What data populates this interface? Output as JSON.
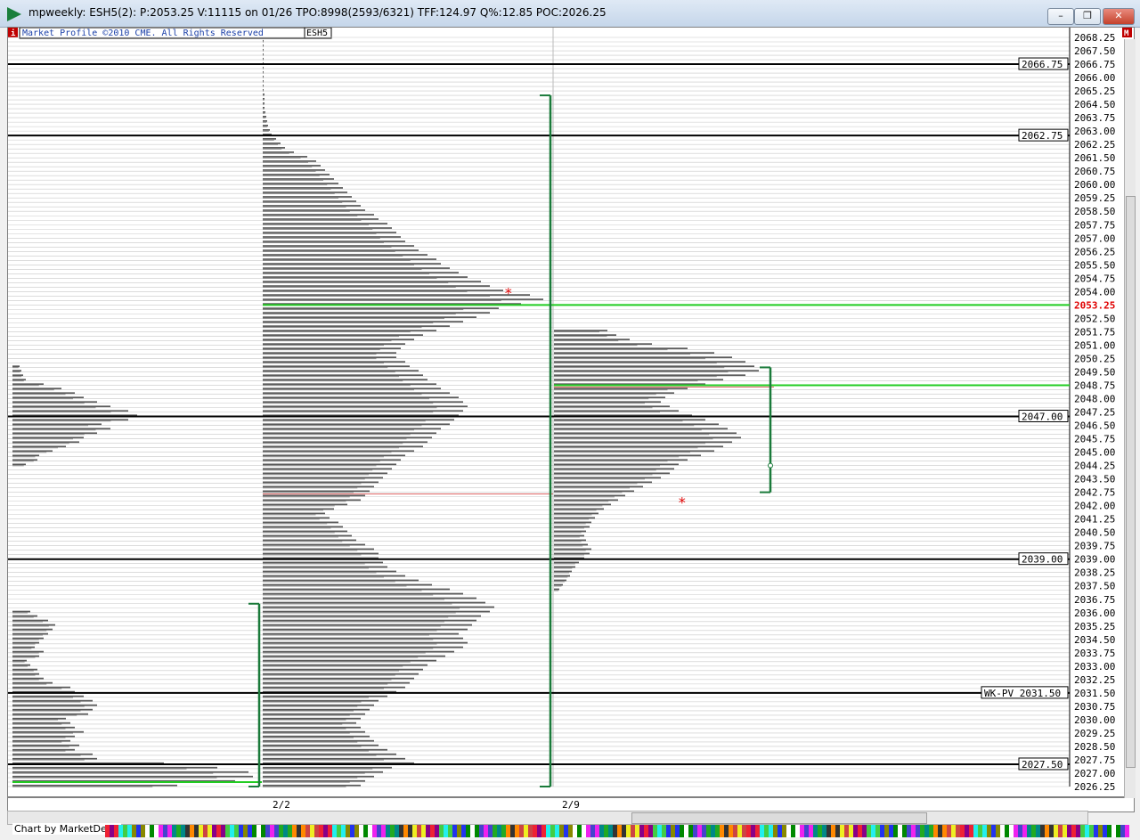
{
  "window": {
    "title": "mpweekly: ESH5(2): P:2053.25 V:11115 on 01/26 TPO:8998(2593/6321) TFF:124.97 Q%:12.85 POC:2026.25",
    "min_label": "–",
    "restore_label": "❒",
    "close_label": "✕"
  },
  "header": {
    "copyright": "Market Profile ©2010 CME. All Rights Reserved",
    "symbol": "ESH5",
    "left_corner": "i",
    "right_corner": "M"
  },
  "footer": {
    "credit": "Chart by MarketDelta"
  },
  "colors": {
    "accent_green": "#1a7f3c",
    "poc_green": "#22cc22",
    "value_area_green": "#1a7a3a",
    "current_price_red": "#e00000",
    "grid": "#c8c8c8",
    "level_line": "#000000"
  },
  "chart_data": {
    "type": "market-profile",
    "y_axis": {
      "min": 2026.25,
      "max": 2068.25,
      "tick_step": 0.25,
      "label_every": 1.25,
      "current_price": 2053.25,
      "labels": [
        "2068.25",
        "2067.50",
        "2066.75",
        "2066.00",
        "2065.25",
        "2064.50",
        "2063.75",
        "2063.00",
        "2062.25",
        "2061.50",
        "2060.75",
        "2060.00",
        "2059.25",
        "2058.50",
        "2057.75",
        "2057.00",
        "2056.25",
        "2055.50",
        "2054.75",
        "2054.00",
        "2053.25",
        "2052.50",
        "2051.75",
        "2051.00",
        "2050.25",
        "2049.50",
        "2048.75",
        "2048.00",
        "2047.25",
        "2046.50",
        "2045.75",
        "2045.00",
        "2044.25",
        "2043.50",
        "2042.75",
        "2042.00",
        "2041.25",
        "2040.50",
        "2039.75",
        "2039.00",
        "2038.25",
        "2037.50",
        "2036.75",
        "2036.00",
        "2035.25",
        "2034.50",
        "2033.75",
        "2033.00",
        "2032.25",
        "2031.50",
        "2030.75",
        "2030.00",
        "2029.25",
        "2028.50",
        "2027.75",
        "2027.00",
        "2026.25"
      ]
    },
    "x_axis": {
      "dates": [
        "2/2",
        "2/9"
      ]
    },
    "levels": [
      {
        "label": "2066.75",
        "price": 2066.75
      },
      {
        "label": "2062.75",
        "price": 2062.75
      },
      {
        "label": "2047.00",
        "price": 2047.0
      },
      {
        "label": "2039.00",
        "price": 2039.0
      },
      {
        "label": "WK-PV 2031.50",
        "price": 2031.5
      },
      {
        "label": "2027.50",
        "price": 2027.5
      }
    ],
    "profiles": [
      {
        "id": "prior-week",
        "low": 2026.25,
        "high": 2049.75,
        "poc": 2026.5,
        "value_area": [
          2026.25,
          2036.5
        ],
        "segments": [
          {
            "from": 2026.25,
            "to": 2029.25,
            "widths": [
              185,
              250,
              270,
              265,
              230,
              170,
              95,
              90,
              70,
              75,
              65,
              70,
              80
            ]
          },
          {
            "from": 2029.5,
            "to": 2036.0,
            "widths": [
              70,
              65,
              60,
              85,
              90,
              95,
              90,
              80,
              70,
              65,
              45,
              35,
              30,
              28,
              20,
              16,
              30,
              35,
              25,
              30,
              35,
              40,
              45,
              48,
              40,
              28,
              20
            ]
          },
          {
            "from": 2044.25,
            "to": 2049.75,
            "widths": [
              15,
              28,
              30,
              45,
              60,
              75,
              80,
              95,
              110,
              100,
              130,
              140,
              130,
              110,
              95,
              80,
              70,
              55,
              35,
              15,
              12,
              10,
              8
            ]
          }
        ]
      },
      {
        "id": "week-2-2",
        "low": 2026.25,
        "high": 2068.25,
        "poc": 2053.25,
        "value_area": [
          2026.25,
          2036.5
        ],
        "single_print_high": 2054.0,
        "segments": [
          {
            "from": 2026.25,
            "to": 2068.25,
            "widths": [
              110,
              115,
              125,
              135,
              145,
              170,
              160,
              150,
              140,
              130,
              125,
              120,
              115,
              110,
              105,
              110,
              115,
              120,
              125,
              130,
              140,
              150,
              160,
              165,
              170,
              175,
              180,
              185,
              195,
              205,
              215,
              225,
              230,
              225,
              220,
              230,
              235,
              240,
              245,
              255,
              260,
              250,
              240,
              225,
              210,
              190,
              175,
              160,
              150,
              140,
              135,
              130,
              130,
              125,
              115,
              105,
              100,
              95,
              90,
              85,
              75,
              70,
              80,
              95,
              110,
              115,
              120,
              125,
              130,
              135,
              140,
              145,
              150,
              155,
              160,
              170,
              180,
              185,
              190,
              195,
              200,
              210,
              215,
              220,
              225,
              230,
              225,
              220,
              210,
              200,
              195,
              185,
              180,
              175,
              165,
              160,
              150,
              150,
              155,
              160,
              170,
              180,
              195,
              210,
              225,
              240,
              255,
              265,
              290,
              315,
              300,
              270,
              255,
              245,
              230,
              220,
              210,
              200,
              195,
              185,
              175,
              170,
              160,
              155,
              150,
              145,
              140,
              130,
              125,
              115,
              110,
              105,
              100,
              95,
              90,
              85,
              80,
              75,
              70,
              65,
              60,
              50,
              35,
              25,
              20,
              15,
              10,
              8,
              6,
              5,
              4,
              3,
              2,
              2,
              2,
              2,
              1,
              1,
              1,
              1,
              1,
              1,
              1,
              1,
              1,
              1,
              1,
              1
            ]
          }
        ]
      },
      {
        "id": "week-2-9",
        "low": 2037.25,
        "high": 2051.75,
        "poc": 2048.75,
        "value_area": [
          2042.75,
          2049.75
        ],
        "single_print_high": 2042.25,
        "segments": [
          {
            "from": 2037.25,
            "to": 2051.75,
            "widths": [
              6,
              10,
              14,
              18,
              20,
              24,
              28,
              34,
              40,
              42,
              38,
              36,
              34,
              36,
              40,
              42,
              46,
              50,
              56,
              64,
              72,
              80,
              90,
              100,
              110,
              120,
              130,
              135,
              140,
              150,
              165,
              180,
              190,
              200,
              210,
              205,
              195,
              185,
              170,
              155,
              140,
              130,
              120,
              125,
              135,
              150,
              170,
              190,
              215,
              230,
              225,
              215,
              200,
              180,
              150,
              110,
              85,
              70,
              60,
              50
            ]
          }
        ]
      }
    ]
  }
}
